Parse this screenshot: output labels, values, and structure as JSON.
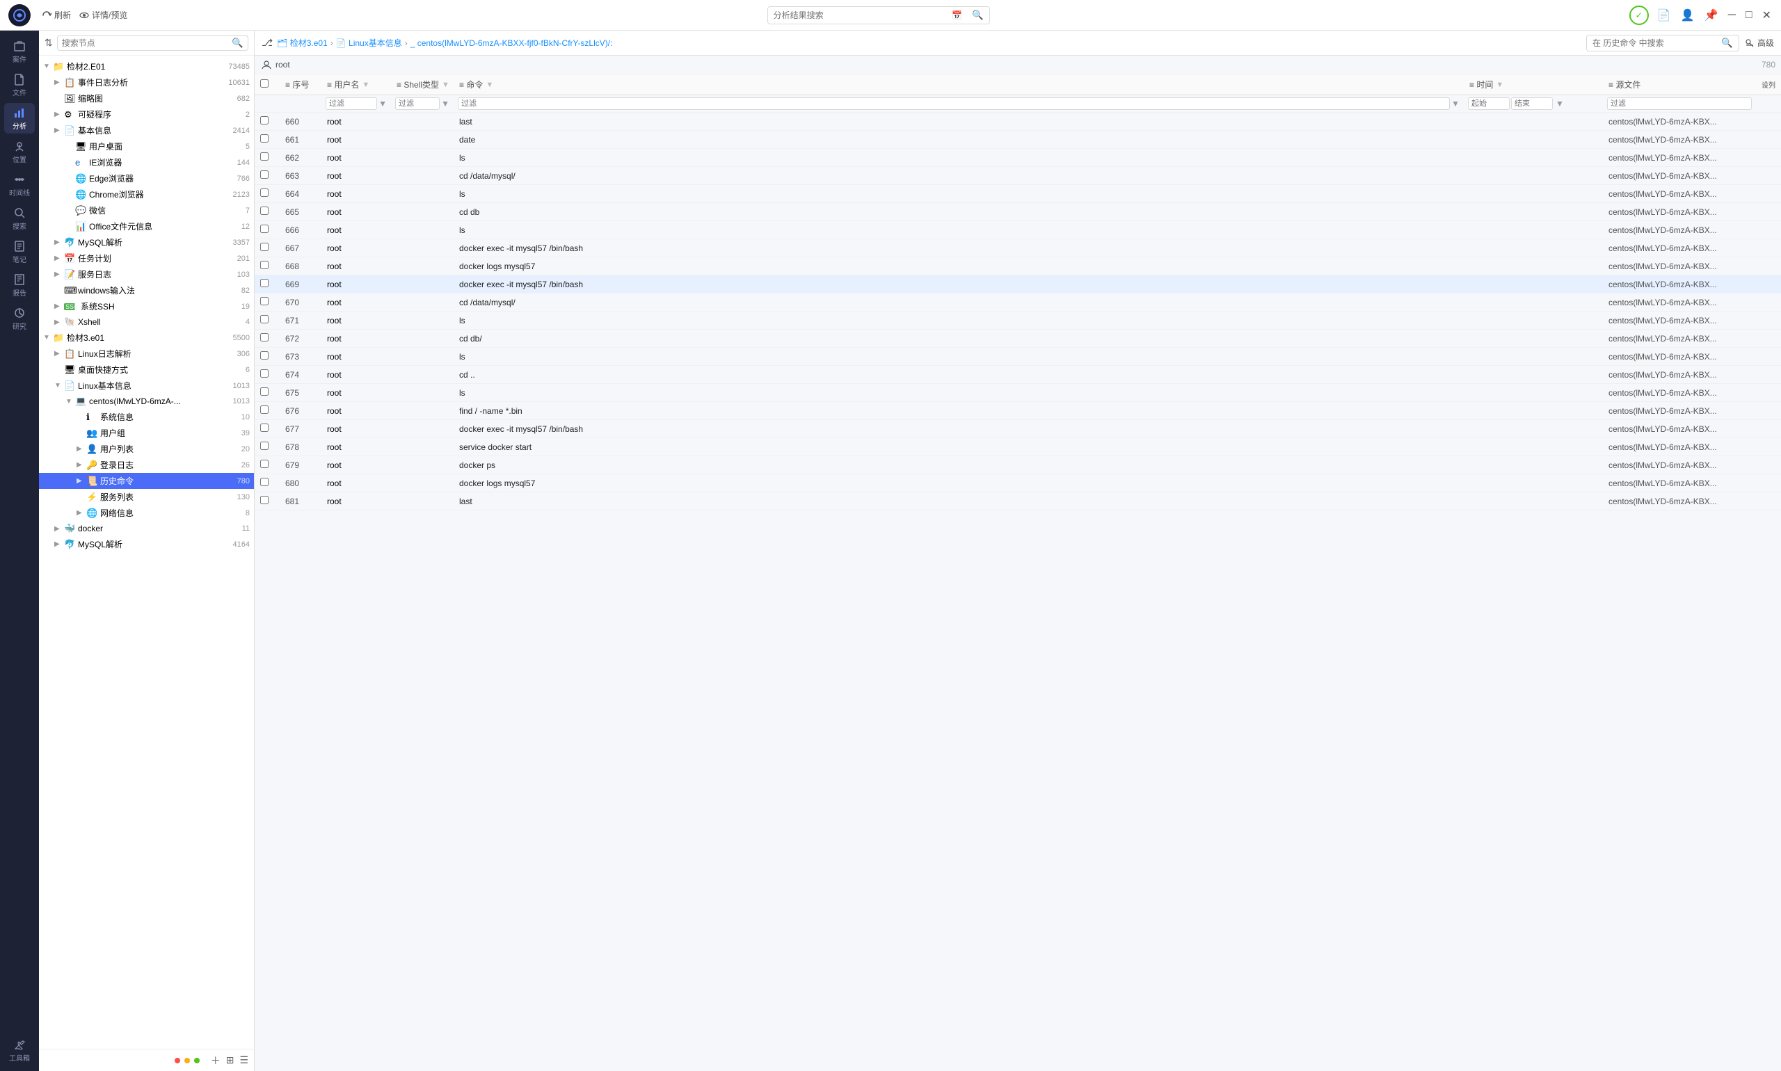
{
  "topbar": {
    "refresh_label": "刷新",
    "detail_label": "详情/预览",
    "search_placeholder": "分析结果搜索",
    "advanced_label": "高级"
  },
  "nav": {
    "items": [
      {
        "id": "case",
        "label": "案件",
        "icon": "folder"
      },
      {
        "id": "file",
        "label": "文件",
        "icon": "file"
      },
      {
        "id": "analysis",
        "label": "分析",
        "icon": "analysis",
        "active": true
      },
      {
        "id": "location",
        "label": "位置",
        "icon": "location"
      },
      {
        "id": "timeline",
        "label": "时间线",
        "icon": "timeline"
      },
      {
        "id": "search",
        "label": "搜索",
        "icon": "search"
      },
      {
        "id": "notes",
        "label": "笔记",
        "icon": "notes"
      },
      {
        "id": "report",
        "label": "报告",
        "icon": "report"
      },
      {
        "id": "research",
        "label": "研究",
        "icon": "research"
      },
      {
        "id": "tools",
        "label": "工具箱",
        "icon": "tools"
      }
    ]
  },
  "tree": {
    "search_placeholder": "搜索节点",
    "nodes": [
      {
        "id": "e01",
        "label": "检材2.E01",
        "count": "73485",
        "level": 0,
        "expanded": true,
        "hasArrow": true,
        "icon": "folder-blue"
      },
      {
        "id": "log",
        "label": "事件日志分析",
        "count": "10631",
        "level": 1,
        "expanded": false,
        "hasArrow": true,
        "icon": "doc"
      },
      {
        "id": "thumb",
        "label": "缩略图",
        "count": "682",
        "level": 1,
        "expanded": false,
        "hasArrow": false,
        "icon": "image"
      },
      {
        "id": "prog",
        "label": "可疑程序",
        "count": "2",
        "level": 1,
        "expanded": false,
        "hasArrow": true,
        "icon": "gear"
      },
      {
        "id": "basic",
        "label": "基本信息",
        "count": "2414",
        "level": 1,
        "expanded": false,
        "hasArrow": true,
        "icon": "doc2"
      },
      {
        "id": "desktop",
        "label": "用户桌面",
        "count": "5",
        "level": 2,
        "expanded": false,
        "hasArrow": false,
        "icon": "desktop"
      },
      {
        "id": "ie",
        "label": "IE浏览器",
        "count": "144",
        "level": 2,
        "expanded": false,
        "hasArrow": false,
        "icon": "ie"
      },
      {
        "id": "edge",
        "label": "Edge浏览器",
        "count": "766",
        "level": 2,
        "expanded": false,
        "hasArrow": false,
        "icon": "edge"
      },
      {
        "id": "chrome",
        "label": "Chrome浏览器",
        "count": "2123",
        "level": 2,
        "expanded": false,
        "hasArrow": false,
        "icon": "chrome"
      },
      {
        "id": "wechat",
        "label": "微信",
        "count": "7",
        "level": 2,
        "expanded": false,
        "hasArrow": false,
        "icon": "wechat"
      },
      {
        "id": "office",
        "label": "Office文件元信息",
        "count": "12",
        "level": 2,
        "expanded": false,
        "hasArrow": false,
        "icon": "office"
      },
      {
        "id": "mysql",
        "label": "MySQL解析",
        "count": "3357",
        "level": 1,
        "expanded": false,
        "hasArrow": true,
        "icon": "mysql"
      },
      {
        "id": "task",
        "label": "任务计划",
        "count": "201",
        "level": 1,
        "expanded": false,
        "hasArrow": true,
        "icon": "task"
      },
      {
        "id": "svclog",
        "label": "服务日志",
        "count": "103",
        "level": 1,
        "expanded": false,
        "hasArrow": true,
        "icon": "log"
      },
      {
        "id": "wininput",
        "label": "windows输入法",
        "count": "82",
        "level": 1,
        "expanded": false,
        "hasArrow": false,
        "icon": "keyboard"
      },
      {
        "id": "ssh",
        "label": "系统SSH",
        "count": "19",
        "level": 1,
        "expanded": false,
        "hasArrow": true,
        "icon": "ssh"
      },
      {
        "id": "xshell",
        "label": "Xshell",
        "count": "4",
        "level": 1,
        "expanded": false,
        "hasArrow": true,
        "icon": "xshell"
      },
      {
        "id": "e01_3",
        "label": "检材3.e01",
        "count": "5500",
        "level": 0,
        "expanded": true,
        "hasArrow": true,
        "icon": "folder-blue"
      },
      {
        "id": "linuxlog",
        "label": "Linux日志解析",
        "count": "306",
        "level": 1,
        "expanded": false,
        "hasArrow": true,
        "icon": "doc"
      },
      {
        "id": "shortcuts",
        "label": "桌面快捷方式",
        "count": "6",
        "level": 1,
        "expanded": false,
        "hasArrow": false,
        "icon": "shortcut"
      },
      {
        "id": "linuxbasic",
        "label": "Linux基本信息",
        "count": "1013",
        "level": 1,
        "expanded": true,
        "hasArrow": true,
        "icon": "doc2"
      },
      {
        "id": "centos",
        "label": "centos(lMwLYD-6mzA-...",
        "count": "1013",
        "level": 2,
        "expanded": true,
        "hasArrow": true,
        "icon": "computer"
      },
      {
        "id": "sysinfo",
        "label": "系统信息",
        "count": "10",
        "level": 3,
        "expanded": false,
        "hasArrow": false,
        "icon": "info"
      },
      {
        "id": "usergroup",
        "label": "用户组",
        "count": "39",
        "level": 3,
        "expanded": false,
        "hasArrow": false,
        "icon": "group"
      },
      {
        "id": "userlist",
        "label": "用户列表",
        "count": "20",
        "level": 3,
        "expanded": false,
        "hasArrow": true,
        "icon": "users"
      },
      {
        "id": "loginlog",
        "label": "登录日志",
        "count": "26",
        "level": 3,
        "expanded": false,
        "hasArrow": true,
        "icon": "login"
      },
      {
        "id": "histcmd",
        "label": "历史命令",
        "count": "780",
        "level": 3,
        "expanded": true,
        "hasArrow": true,
        "icon": "cmd",
        "active": true
      },
      {
        "id": "svclist",
        "label": "服务列表",
        "count": "130",
        "level": 3,
        "expanded": false,
        "hasArrow": false,
        "icon": "svc"
      },
      {
        "id": "netinfo",
        "label": "网络信息",
        "count": "8",
        "level": 3,
        "expanded": false,
        "hasArrow": true,
        "icon": "net"
      },
      {
        "id": "docker",
        "label": "docker",
        "count": "11",
        "level": 1,
        "expanded": false,
        "hasArrow": true,
        "icon": "docker"
      },
      {
        "id": "mysqlparse",
        "label": "MySQL解析",
        "count": "4164",
        "level": 1,
        "expanded": false,
        "hasArrow": true,
        "icon": "mysql"
      }
    ],
    "root_node": {
      "label": "root",
      "count": "780"
    }
  },
  "breadcrumb": {
    "items": [
      {
        "label": "检材3.e01"
      },
      {
        "label": "Linux基本信息"
      },
      {
        "label": "centos(lMwLYD-6mzA-KBXX-fjf0-fBkN-CfrY-szLlcV)/:"
      }
    ]
  },
  "history_search": {
    "placeholder": "在 历史命令 中搜索"
  },
  "table": {
    "columns": [
      {
        "id": "check",
        "label": ""
      },
      {
        "id": "seq",
        "label": "序号"
      },
      {
        "id": "user",
        "label": "用户名"
      },
      {
        "id": "shell",
        "label": "Shell类型"
      },
      {
        "id": "cmd",
        "label": "命令"
      },
      {
        "id": "time",
        "label": "时间"
      },
      {
        "id": "src",
        "label": "源文件"
      },
      {
        "id": "settings",
        "label": "设列"
      }
    ],
    "filters": {
      "user": "过滤",
      "shell": "过滤",
      "cmd": "过滤",
      "time_start": "起始",
      "time_end": "结束",
      "src": "过滤"
    },
    "rows": [
      {
        "seq": "660",
        "user": "root",
        "shell": "",
        "cmd": "last",
        "time": "",
        "src": "centos(lMwLYD-6mzA-KBX..."
      },
      {
        "seq": "661",
        "user": "root",
        "shell": "",
        "cmd": "date",
        "time": "",
        "src": "centos(lMwLYD-6mzA-KBX..."
      },
      {
        "seq": "662",
        "user": "root",
        "shell": "",
        "cmd": "ls",
        "time": "",
        "src": "centos(lMwLYD-6mzA-KBX..."
      },
      {
        "seq": "663",
        "user": "root",
        "shell": "",
        "cmd": "cd /data/mysql/",
        "time": "",
        "src": "centos(lMwLYD-6mzA-KBX..."
      },
      {
        "seq": "664",
        "user": "root",
        "shell": "",
        "cmd": "ls",
        "time": "",
        "src": "centos(lMwLYD-6mzA-KBX..."
      },
      {
        "seq": "665",
        "user": "root",
        "shell": "",
        "cmd": "cd db",
        "time": "",
        "src": "centos(lMwLYD-6mzA-KBX..."
      },
      {
        "seq": "666",
        "user": "root",
        "shell": "",
        "cmd": "ls",
        "time": "",
        "src": "centos(lMwLYD-6mzA-KBX..."
      },
      {
        "seq": "667",
        "user": "root",
        "shell": "",
        "cmd": "docker exec -it mysql57 /bin/bash",
        "time": "",
        "src": "centos(lMwLYD-6mzA-KBX..."
      },
      {
        "seq": "668",
        "user": "root",
        "shell": "",
        "cmd": "docker logs mysql57",
        "time": "",
        "src": "centos(lMwLYD-6mzA-KBX..."
      },
      {
        "seq": "669",
        "user": "root",
        "shell": "",
        "cmd": "docker exec -it mysql57 /bin/bash",
        "time": "",
        "src": "centos(lMwLYD-6mzA-KBX...",
        "highlighted": true
      },
      {
        "seq": "670",
        "user": "root",
        "shell": "",
        "cmd": "cd /data/mysql/",
        "time": "",
        "src": "centos(lMwLYD-6mzA-KBX..."
      },
      {
        "seq": "671",
        "user": "root",
        "shell": "",
        "cmd": "ls",
        "time": "",
        "src": "centos(lMwLYD-6mzA-KBX..."
      },
      {
        "seq": "672",
        "user": "root",
        "shell": "",
        "cmd": "cd db/",
        "time": "",
        "src": "centos(lMwLYD-6mzA-KBX..."
      },
      {
        "seq": "673",
        "user": "root",
        "shell": "",
        "cmd": "ls",
        "time": "",
        "src": "centos(lMwLYD-6mzA-KBX..."
      },
      {
        "seq": "674",
        "user": "root",
        "shell": "",
        "cmd": "cd ..",
        "time": "",
        "src": "centos(lMwLYD-6mzA-KBX..."
      },
      {
        "seq": "675",
        "user": "root",
        "shell": "",
        "cmd": "ls",
        "time": "",
        "src": "centos(lMwLYD-6mzA-KBX..."
      },
      {
        "seq": "676",
        "user": "root",
        "shell": "",
        "cmd": "find / -name *.bin",
        "time": "",
        "src": "centos(lMwLYD-6mzA-KBX..."
      },
      {
        "seq": "677",
        "user": "root",
        "shell": "",
        "cmd": "docker exec -it mysql57 /bin/bash",
        "time": "",
        "src": "centos(lMwLYD-6mzA-KBX..."
      },
      {
        "seq": "678",
        "user": "root",
        "shell": "",
        "cmd": "service docker start",
        "time": "",
        "src": "centos(lMwLYD-6mzA-KBX..."
      },
      {
        "seq": "679",
        "user": "root",
        "shell": "",
        "cmd": "docker ps",
        "time": "",
        "src": "centos(lMwLYD-6mzA-KBX..."
      },
      {
        "seq": "680",
        "user": "root",
        "shell": "",
        "cmd": "docker logs mysql57",
        "time": "",
        "src": "centos(lMwLYD-6mzA-KBX..."
      },
      {
        "seq": "681",
        "user": "root",
        "shell": "",
        "cmd": "last",
        "time": "",
        "src": "centos(lMwLYD-6mzA-KBX..."
      }
    ]
  }
}
